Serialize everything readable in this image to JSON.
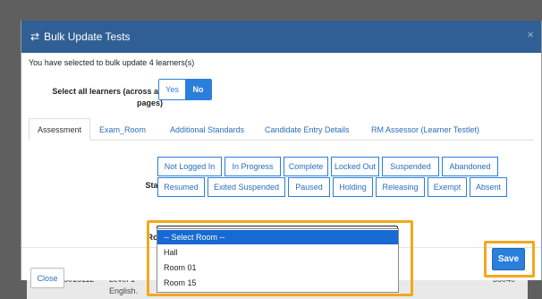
{
  "modal": {
    "title": "Bulk Update Tests",
    "notice": "You have selected to bulk update 4 learners(s)",
    "select_all": {
      "label_line1": "Select all learners (across all",
      "label_line2": "pages)",
      "yes": "Yes",
      "no": "No",
      "selected": "No"
    },
    "tabs": [
      "Assessment",
      "Exam_Room",
      "Additional Standards",
      "Candidate Entry Details",
      "RM Assessor (Learner Testlet)"
    ],
    "active_tab": "Assessment",
    "status_label": "Status",
    "status_buttons_row1": [
      "Not Logged In",
      "In Progress",
      "Complete",
      "Locked Out",
      "Suspended",
      "Abandoned"
    ],
    "status_buttons_row2": [
      "Resumed",
      "Exited Suspended",
      "Paused",
      "Holding",
      "Releasing",
      "Exempt",
      "Absent"
    ],
    "room_label": "Room",
    "room_value": "",
    "room_options": [
      "-- Select Room --",
      "Hall",
      "Room 01",
      "Room 15"
    ],
    "room_highlighted_option": "-- Select Room --",
    "close_label": "Close",
    "save_label": "Save"
  },
  "background": {
    "row_id": "15015112",
    "row_level": "Level 1",
    "row_subject": "English.",
    "row_code": "36040"
  },
  "colors": {
    "header": "#2f5f94",
    "accent": "#2a7fdc",
    "highlight": "#f2a81d",
    "selected_option": "#1769d3"
  },
  "icons": {
    "title_icon": "swap-arrows-icon",
    "close_icon": "close-icon"
  }
}
